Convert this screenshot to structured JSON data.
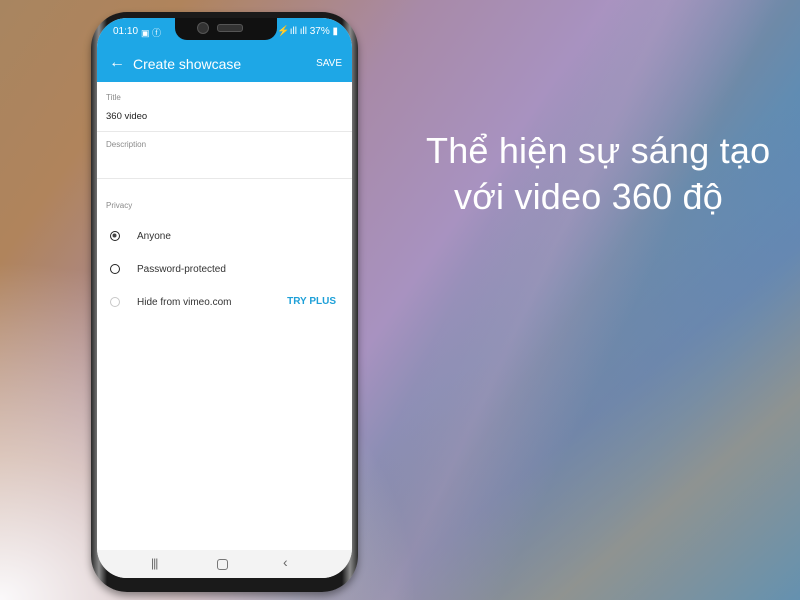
{
  "headline": {
    "line1": "Thể hiện sự sáng tạo",
    "line2": "với video 360 độ"
  },
  "status_bar": {
    "time": "01:10",
    "left_icons": "▣ ⓕ",
    "right_text": "⚡ıll ıll 37% ▮",
    "battery": "37%"
  },
  "app_bar": {
    "back_icon": "←",
    "title": "Create showcase",
    "save_label": "SAVE"
  },
  "form": {
    "title_label": "Title",
    "title_value": "360 video",
    "description_label": "Description",
    "description_value": "",
    "privacy_label": "Privacy",
    "privacy_options": [
      {
        "label": "Anyone",
        "selected": true,
        "enabled": true
      },
      {
        "label": "Password-protected",
        "selected": false,
        "enabled": true
      },
      {
        "label": "Hide from vimeo.com",
        "selected": false,
        "enabled": false
      }
    ],
    "try_plus_label": "TRY PLUS"
  },
  "nav_bar": {
    "recents_icon": "|||",
    "back_icon": "‹"
  },
  "colors": {
    "accent": "#1ea7e6",
    "link": "#1ea0d8"
  }
}
